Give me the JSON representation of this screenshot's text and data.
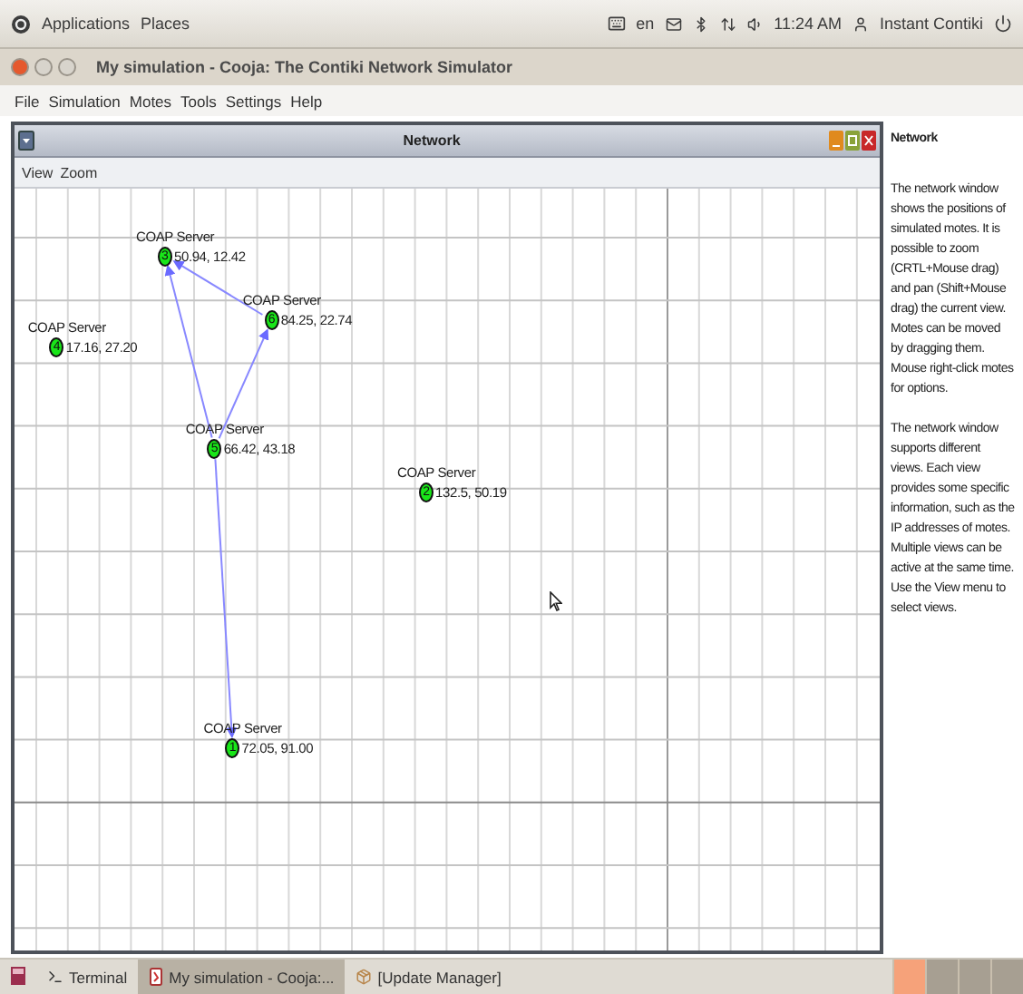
{
  "top_panel": {
    "menus": [
      "Applications",
      "Places"
    ],
    "language": "en",
    "clock": "11:24 AM",
    "user": "Instant Contiki"
  },
  "window": {
    "title": "My simulation - Cooja: The Contiki Network Simulator"
  },
  "menu_bar": [
    "File",
    "Simulation",
    "Motes",
    "Tools",
    "Settings",
    "Help"
  ],
  "network_frame": {
    "title": "Network",
    "menus": [
      "View",
      "Zoom"
    ],
    "motes": [
      {
        "id": "3",
        "label": "COAP Server",
        "position": "50.94, 12.42"
      },
      {
        "id": "6",
        "label": "COAP Server",
        "position": "84.25, 22.74"
      },
      {
        "id": "4",
        "label": "COAP Server",
        "position": "17.16, 27.20"
      },
      {
        "id": "5",
        "label": "COAP Server",
        "position": "66.42, 43.18"
      },
      {
        "id": "2",
        "label": "COAP Server",
        "position": "132.5, 50.19"
      },
      {
        "id": "1",
        "label": "COAP Server",
        "position": "72.05, 91.00"
      }
    ]
  },
  "help_panel": {
    "title": "Network",
    "paragraphs": [
      "The network window shows the positions of simulated motes. It is possible to zoom (CRTL+Mouse drag) and pan (Shift+Mouse drag) the current view. Motes can be moved by dragging them. Mouse right-click motes for options.",
      "The network window supports different views. Each view provides some specific information, such as the IP addresses of motes. Multiple views can be active at the same time. Use the View menu to select views."
    ]
  },
  "taskbar": {
    "items": [
      {
        "kind": "terminal",
        "label": "Terminal",
        "selected": false
      },
      {
        "kind": "java",
        "label": "My simulation - Cooja:...",
        "selected": true
      },
      {
        "kind": "package",
        "label": "[Update Manager]",
        "selected": false
      }
    ]
  }
}
